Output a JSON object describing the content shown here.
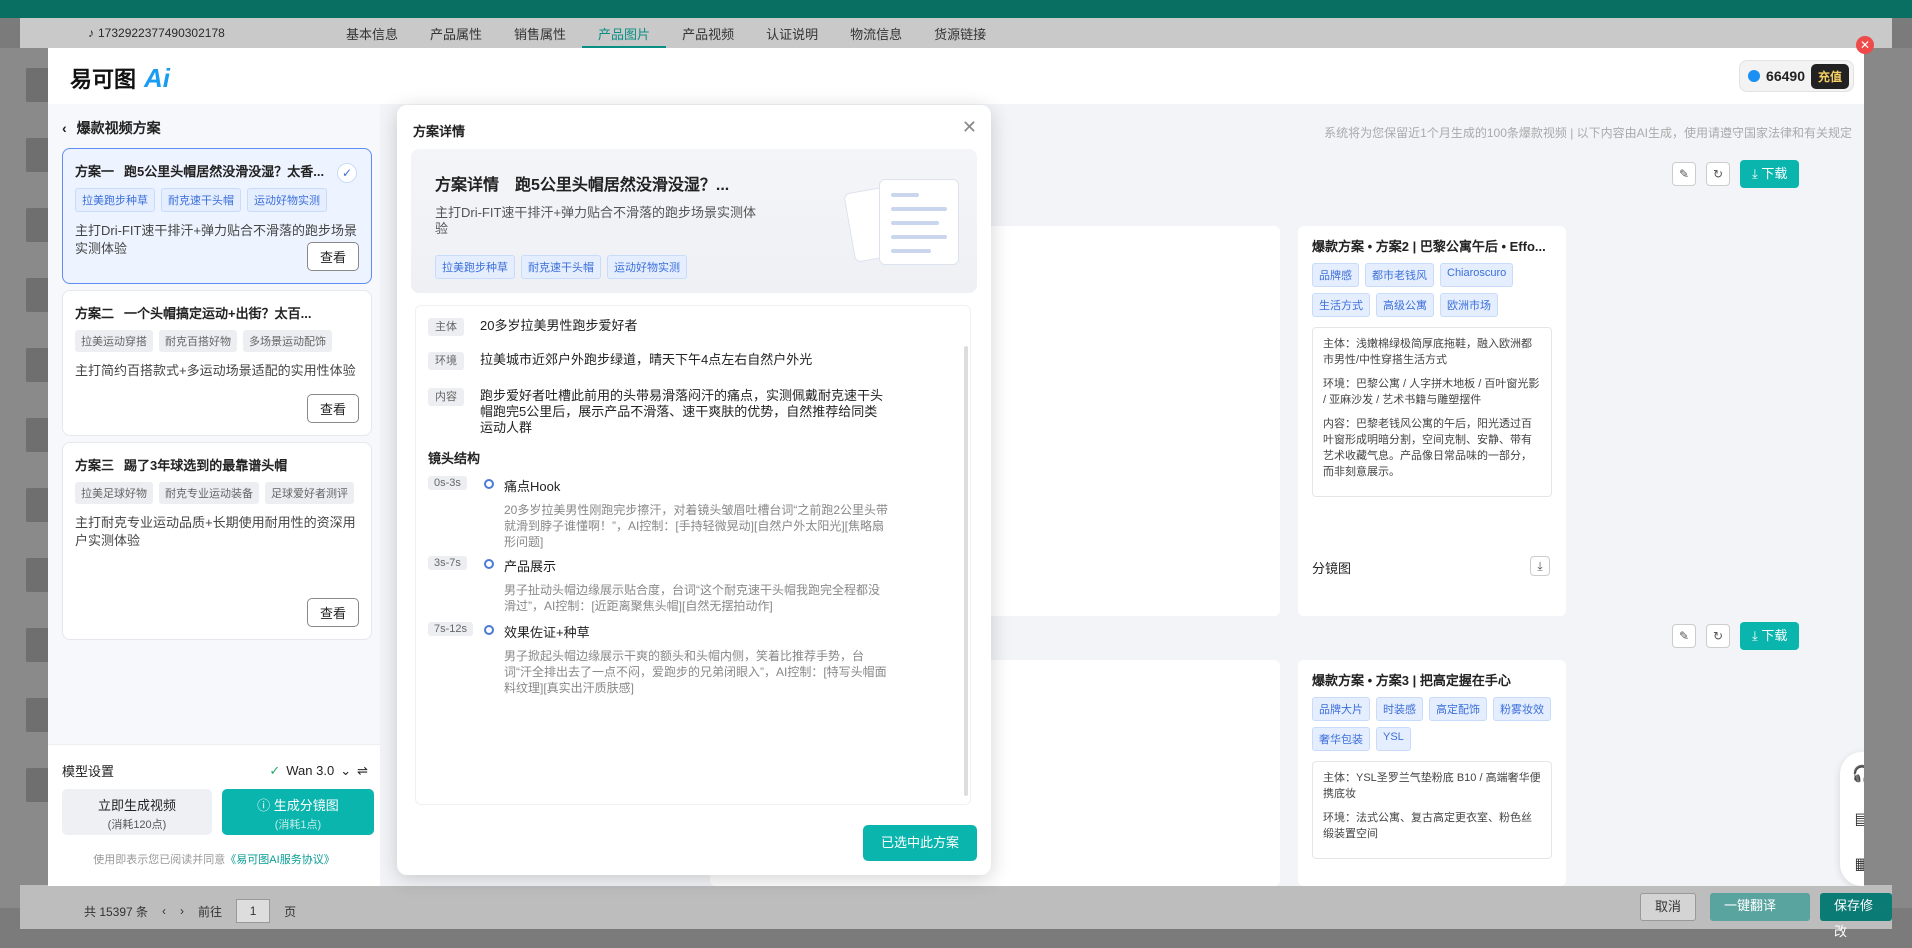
{
  "background": {
    "product_id": "1732922377490302178",
    "tabs": [
      "基本信息",
      "产品属性",
      "销售属性",
      "产品图片",
      "产品视频",
      "认证说明",
      "物流信息",
      "货源链接"
    ],
    "active_tab": 3,
    "pagination": {
      "total": "共 15397 条",
      "goto": "前往",
      "page": "1",
      "page_suffix": "页"
    },
    "footer_buttons": {
      "cancel": "取消",
      "translate": "一键翻译",
      "save": "保存修改"
    }
  },
  "header": {
    "logo_text": "易可图",
    "logo_ai": "Ai",
    "credits": "66490",
    "topup": "充值"
  },
  "sidebar": {
    "title": "爆款视频方案",
    "cards": [
      {
        "label": "方案一",
        "title": "跑5公里头帽居然没滑没湿？太香...",
        "tags": [
          "拉美跑步种草",
          "耐克速干头帽",
          "运动好物实测"
        ],
        "desc": "主打Dri-FIT速干排汗+弹力贴合不滑落的跑步场景实测体验",
        "view": "查看",
        "selected": true
      },
      {
        "label": "方案二",
        "title": "一个头帽搞定运动+出街？太百...",
        "tags": [
          "拉美运动穿搭",
          "耐克百搭好物",
          "多场景运动配饰"
        ],
        "desc": "主打简约百搭款式+多运动场景适配的实用性体验",
        "view": "查看",
        "selected": false
      },
      {
        "label": "方案三",
        "title": "踢了3年球选到的最靠谱头帽",
        "tags": [
          "拉美足球好物",
          "耐克专业运动装备",
          "足球爱好者测评"
        ],
        "desc": "主打耐克专业运动品质+长期使用耐用性的资深用户实测体验",
        "view": "查看",
        "selected": false
      }
    ],
    "model_label": "模型设置",
    "model_value": "Wan 3.0",
    "btn_generate_video": "立即生成视频",
    "btn_generate_video_cost": "(消耗120点)",
    "btn_storyboard": "生成分镜图",
    "btn_storyboard_cost": "(消耗1点)",
    "agreement_prefix": "使用即表示您已阅读并同意",
    "agreement_link": "《易可图AI服务协议》"
  },
  "content": {
    "notice": "系统将为您保留近1个月生成的100条爆款视频  |  以下内容由AI生成，使用请遵守国家法律和有关规定",
    "download_label": "下载",
    "plan2": {
      "title": "爆款方案 • 方案2 | 巴黎公寓午后 • Effo...",
      "tags": [
        "品牌感",
        "都市老钱风",
        "Chiaroscuro",
        "生活方式",
        "高级公寓",
        "欧洲市场"
      ],
      "subject": "主体：浅嫩棉绿极简厚底拖鞋，融入欧洲都市男性/中性穿搭生活方式",
      "env": "环境：巴黎公寓 / 人字拼木地板 / 百叶窗光影 / 亚麻沙发 / 艺术书籍与雕塑摆件",
      "content": "内容：巴黎老钱风公寓的午后，阳光透过百叶窗形成明暗分割，空间克制、安静、带有艺术收藏气息。产品像日常品味的一部分，而非刻意展示。",
      "storyboard": "分镜图"
    },
    "plan3": {
      "title": "爆款方案 • 方案3 | 把高定握在手心",
      "tags": [
        "品牌大片",
        "时装感",
        "高定配饰",
        "粉雾妆效",
        "奢华包装",
        "YSL"
      ],
      "subject": "主体：YSL圣罗兰气垫粉底 B10 / 高端奢华便携底妆",
      "env": "环境：法式公寓、复古高定更衣室、粉色丝缎装置空间"
    }
  },
  "detail": {
    "panel_title": "方案详情",
    "hero_label": "方案详情",
    "hero_title": "跑5公里头帽居然没滑没湿？...",
    "hero_desc": "主打Dri-FIT速干排汗+弹力贴合不滑落的跑步场景实测体验",
    "hero_tags": [
      "拉美跑步种草",
      "耐克速干头帽",
      "运动好物实测"
    ],
    "subject_label": "主体",
    "subject": "20多岁拉美男性跑步爱好者",
    "env_label": "环境",
    "env": "拉美城市近郊户外跑步绿道，晴天下午4点左右自然户外光",
    "content_label": "内容",
    "content": "跑步爱好者吐槽此前用的头带易滑落闷汗的痛点，实测佩戴耐克速干头帽跑完5公里后，展示产品不滑落、速干爽肤的优势，自然推荐给同类运动人群",
    "shots_title": "镜头结构",
    "shots": [
      {
        "time": "0s-3s",
        "name": "痛点Hook",
        "desc": "20多岁拉美男性刚跑完步擦汗，对着镜头皱眉吐槽台词“之前跑2公里头带就滑到脖子谁懂啊！”，AI控制：[手持轻微晃动][自然户外太阳光][焦略扇形问题]"
      },
      {
        "time": "3s-7s",
        "name": "产品展示",
        "desc": "男子扯动头帽边缘展示贴合度，台词“这个耐克速干头帽我跑完全程都没滑过”，AI控制：[近距离聚焦头帽][自然无摆拍动作]"
      },
      {
        "time": "7s-12s",
        "name": "效果佐证+种草",
        "desc": "男子掀起头帽边缘展示干爽的额头和头帽内侧，笑着比推荐手势，台词“汗全排出去了一点不闷，爱跑步的兄弟闭眼入”，AI控制：[特写头帽面料纹理][真实出汗质肤感]"
      }
    ],
    "confirm": "已选中此方案"
  }
}
